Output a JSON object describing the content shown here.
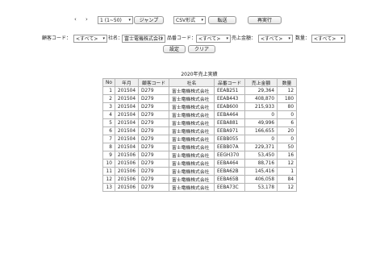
{
  "pager": {
    "prev_arrow": "‹",
    "next_arrow": "›",
    "page_select_value": "1 (1~50)",
    "jump_label": "ジャンプ",
    "format_select_value": "CSV形式",
    "transfer_label": "転送",
    "rerun_label": "再実行"
  },
  "filters": {
    "customer_code_label": "顧客コード：",
    "customer_code_value": "<すべて>",
    "company_label": "社名：",
    "company_value": "富士電機株式会社",
    "product_code_label": "品番コード：",
    "product_code_value": "<すべて>",
    "sales_amount_label": "売上金額：",
    "sales_amount_value": "<すべて>",
    "quantity_label": "数量：",
    "quantity_value": "<すべて>",
    "set_label": "設定",
    "clear_label": "クリア"
  },
  "table": {
    "caption": "2020年売上実績",
    "headers": [
      "No",
      "年月",
      "顧客コード",
      "社名",
      "品番コード",
      "売上金額",
      "数量"
    ],
    "rows": [
      [
        "1",
        "201504",
        "D279",
        "富士電機株式会社",
        "EEAB251",
        "29,364",
        "12"
      ],
      [
        "2",
        "201504",
        "D279",
        "富士電機株式会社",
        "EEAB443",
        "408,870",
        "180"
      ],
      [
        "3",
        "201504",
        "D279",
        "富士電機株式会社",
        "EEAB600",
        "215,933",
        "80"
      ],
      [
        "4",
        "201504",
        "D279",
        "富士電機株式会社",
        "EEBA464",
        "0",
        "0"
      ],
      [
        "5",
        "201504",
        "D279",
        "富士電機株式会社",
        "EEBA881",
        "49,996",
        "6"
      ],
      [
        "6",
        "201504",
        "D279",
        "富士電機株式会社",
        "EEBA971",
        "166,655",
        "20"
      ],
      [
        "7",
        "201504",
        "D279",
        "富士電機株式会社",
        "EEBB055",
        "0",
        "0"
      ],
      [
        "8",
        "201504",
        "D279",
        "富士電機株式会社",
        "EEBB07A",
        "229,371",
        "50"
      ],
      [
        "9",
        "201506",
        "D279",
        "富士電機株式会社",
        "EEGH370",
        "53,450",
        "16"
      ],
      [
        "10",
        "201506",
        "D279",
        "富士電機株式会社",
        "EEBA464",
        "88,716",
        "12"
      ],
      [
        "11",
        "201506",
        "D279",
        "富士電機株式会社",
        "EEBA62B",
        "145,416",
        "1"
      ],
      [
        "12",
        "201506",
        "D279",
        "富士電機株式会社",
        "EEBA65B",
        "406,058",
        "84"
      ],
      [
        "13",
        "201506",
        "D279",
        "富士電機株式会社",
        "EEBA73C",
        "53,178",
        "12"
      ]
    ]
  }
}
